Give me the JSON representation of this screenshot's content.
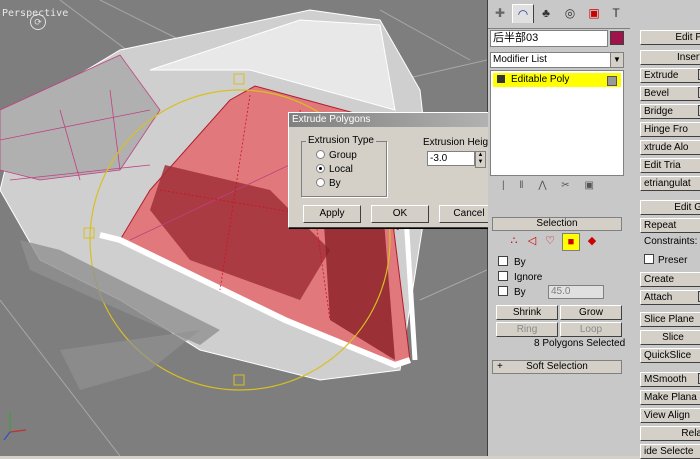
{
  "viewport": {
    "label": "Perspective",
    "nav_glyph": "⟳"
  },
  "dialog": {
    "title": "Extrude Polygons",
    "group_label": "Extrusion Type",
    "options": [
      {
        "label": "Group",
        "selected": false
      },
      {
        "label": "Local",
        "selected": true
      },
      {
        "label": "By",
        "selected": false
      }
    ],
    "height_label": "Extrusion Height:",
    "height_value": "-3.0",
    "buttons": {
      "apply": "Apply",
      "ok": "OK",
      "cancel": "Cancel"
    }
  },
  "command_panel": {
    "tabs": [
      "create-icon",
      "modify-icon",
      "hierarchy-icon",
      "motion-icon",
      "display-icon",
      "utilities-icon"
    ],
    "object_name": "后半部03",
    "object_color": "#a0124a",
    "modifier_list": "Modifier List",
    "stack_item": "Editable Poly",
    "selection": {
      "header": "Selection",
      "by": "By",
      "ignore": "Ignore",
      "by_angle": "By",
      "angle_value": "45.0",
      "shrink": "Shrink",
      "grow": "Grow",
      "ring": "Ring",
      "loop": "Loop",
      "status": "8 Polygons Selected"
    },
    "soft_selection": "Soft Selection",
    "edit_poly_rollout": {
      "header": "Edit P",
      "buttons": [
        "Insert",
        "Extrude",
        "Bevel",
        "Bridge",
        "Hinge Fro",
        "xtrude Alo",
        "Edit Tria",
        "etriangulat"
      ]
    },
    "edit_geometry_rollout": {
      "header": "Edit G",
      "repeat": "Repeat",
      "constraints": "Constraints:",
      "preserve": "Preser",
      "create": "Create",
      "attach": "Attach",
      "slice_plane": "Slice Plane",
      "slice": "Slice",
      "quickslice": "QuickSlice",
      "msmooth": "MSmooth",
      "make_planar": "Make Plana",
      "view_align": "View Align",
      "relax": "Rela",
      "hide_selected": "ide Selecte"
    }
  }
}
